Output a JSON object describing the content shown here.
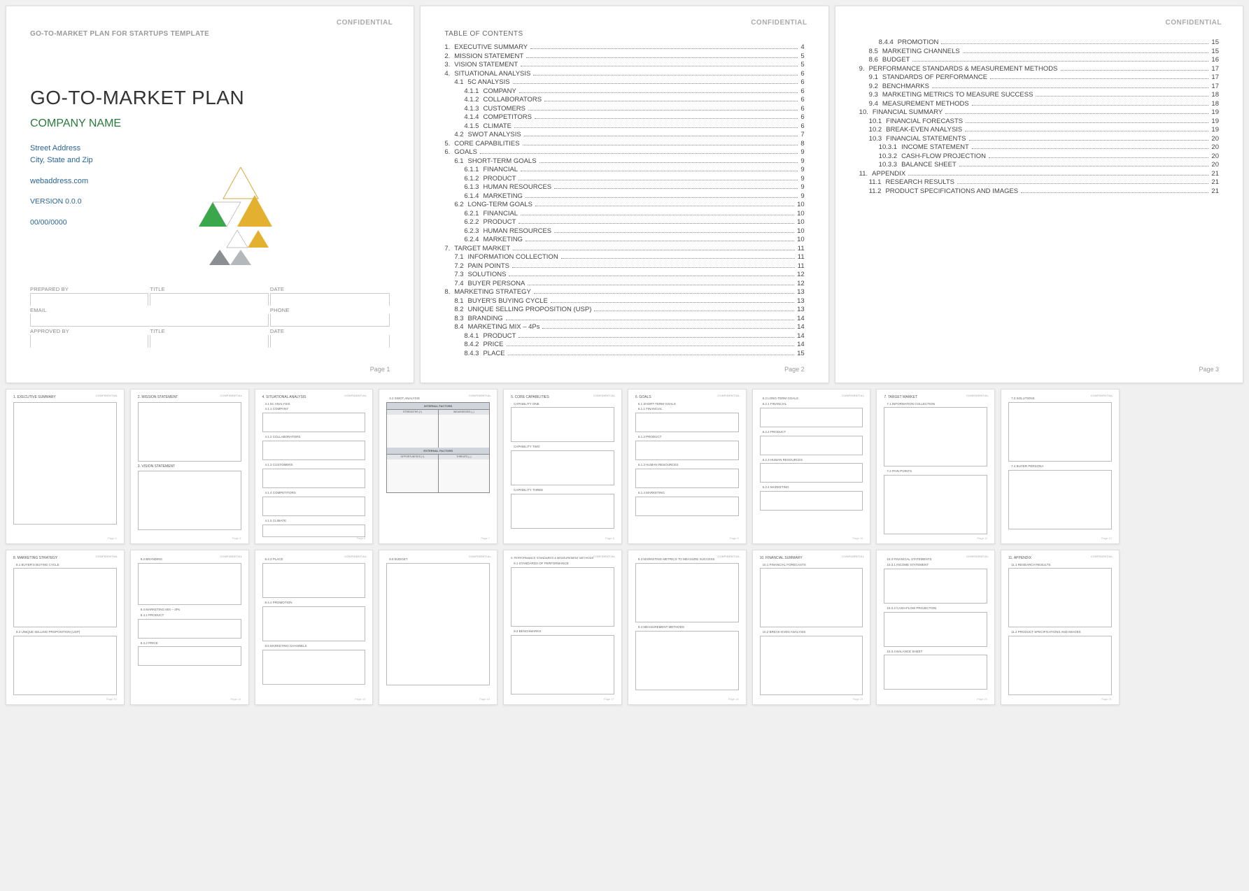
{
  "confidential": "CONFIDENTIAL",
  "template_header": "GO-TO-MARKET PLAN FOR STARTUPS TEMPLATE",
  "main_title": "GO-TO-MARKET PLAN",
  "company": "COMPANY NAME",
  "street": "Street Address",
  "city": "City, State and Zip",
  "web": "webaddress.com",
  "version": "VERSION 0.0.0",
  "date": "00/00/0000",
  "form": {
    "prepared_by": "PREPARED BY",
    "title": "TITLE",
    "date": "DATE",
    "email": "EMAIL",
    "phone": "PHONE",
    "approved_by": "APPROVED BY"
  },
  "pages": {
    "p1": "Page 1",
    "p2": "Page 2",
    "p3": "Page 3"
  },
  "toc_title": "TABLE OF CONTENTS",
  "toc_page2": [
    {
      "n": "1.",
      "t": "EXECUTIVE SUMMARY",
      "p": "4",
      "i": 0
    },
    {
      "n": "2.",
      "t": "MISSION STATEMENT",
      "p": "5",
      "i": 0
    },
    {
      "n": "3.",
      "t": "VISION STATEMENT",
      "p": "5",
      "i": 0
    },
    {
      "n": "4.",
      "t": "SITUATIONAL ANALYSIS",
      "p": "6",
      "i": 0
    },
    {
      "n": "4.1",
      "t": "5C ANALYSIS",
      "p": "6",
      "i": 1
    },
    {
      "n": "4.1.1",
      "t": "COMPANY",
      "p": "6",
      "i": 2
    },
    {
      "n": "4.1.2",
      "t": "COLLABORATORS",
      "p": "6",
      "i": 2
    },
    {
      "n": "4.1.3",
      "t": "CUSTOMERS",
      "p": "6",
      "i": 2
    },
    {
      "n": "4.1.4",
      "t": "COMPETITORS",
      "p": "6",
      "i": 2
    },
    {
      "n": "4.1.5",
      "t": "CLIMATE",
      "p": "6",
      "i": 2
    },
    {
      "n": "4.2",
      "t": "SWOT ANALYSIS",
      "p": "7",
      "i": 1
    },
    {
      "n": "5.",
      "t": "CORE CAPABILITIES",
      "p": "8",
      "i": 0
    },
    {
      "n": "6.",
      "t": "GOALS",
      "p": "9",
      "i": 0
    },
    {
      "n": "6.1",
      "t": "SHORT-TERM GOALS",
      "p": "9",
      "i": 1
    },
    {
      "n": "6.1.1",
      "t": "FINANCIAL",
      "p": "9",
      "i": 2
    },
    {
      "n": "6.1.2",
      "t": "PRODUCT",
      "p": "9",
      "i": 2
    },
    {
      "n": "6.1.3",
      "t": "HUMAN RESOURCES",
      "p": "9",
      "i": 2
    },
    {
      "n": "6.1.4",
      "t": "MARKETING",
      "p": "9",
      "i": 2
    },
    {
      "n": "6.2",
      "t": "LONG-TERM GOALS",
      "p": "10",
      "i": 1
    },
    {
      "n": "6.2.1",
      "t": "FINANCIAL",
      "p": "10",
      "i": 2
    },
    {
      "n": "6.2.2",
      "t": "PRODUCT",
      "p": "10",
      "i": 2
    },
    {
      "n": "6.2.3",
      "t": "HUMAN RESOURCES",
      "p": "10",
      "i": 2
    },
    {
      "n": "6.2.4",
      "t": "MARKETING",
      "p": "10",
      "i": 2
    },
    {
      "n": "7.",
      "t": "TARGET MARKET",
      "p": "11",
      "i": 0
    },
    {
      "n": "7.1",
      "t": "INFORMATION COLLECTION",
      "p": "11",
      "i": 1
    },
    {
      "n": "7.2",
      "t": "PAIN POINTS",
      "p": "11",
      "i": 1
    },
    {
      "n": "7.3",
      "t": "SOLUTIONS",
      "p": "12",
      "i": 1
    },
    {
      "n": "7.4",
      "t": "BUYER PERSONA",
      "p": "12",
      "i": 1
    },
    {
      "n": "8.",
      "t": "MARKETING STRATEGY",
      "p": "13",
      "i": 0
    },
    {
      "n": "8.1",
      "t": "BUYER'S BUYING CYCLE",
      "p": "13",
      "i": 1
    },
    {
      "n": "8.2",
      "t": "UNIQUE SELLING PROPOSITION (USP)",
      "p": "13",
      "i": 1
    },
    {
      "n": "8.3",
      "t": "BRANDING",
      "p": "14",
      "i": 1
    },
    {
      "n": "8.4",
      "t": "MARKETING MIX – 4Ps",
      "p": "14",
      "i": 1
    },
    {
      "n": "8.4.1",
      "t": "PRODUCT",
      "p": "14",
      "i": 2
    },
    {
      "n": "8.4.2",
      "t": "PRICE",
      "p": "14",
      "i": 2
    },
    {
      "n": "8.4.3",
      "t": "PLACE",
      "p": "15",
      "i": 2
    }
  ],
  "toc_page3": [
    {
      "n": "8.4.4",
      "t": "PROMOTION",
      "p": "15",
      "i": 2
    },
    {
      "n": "8.5",
      "t": "MARKETING CHANNELS",
      "p": "15",
      "i": 1
    },
    {
      "n": "8.6",
      "t": "BUDGET",
      "p": "16",
      "i": 1
    },
    {
      "n": "9.",
      "t": "PERFORMANCE STANDARDS & MEASUREMENT METHODS",
      "p": "17",
      "i": 0
    },
    {
      "n": "9.1",
      "t": "STANDARDS OF PERFORMANCE",
      "p": "17",
      "i": 1
    },
    {
      "n": "9.2",
      "t": "BENCHMARKS",
      "p": "17",
      "i": 1
    },
    {
      "n": "9.3",
      "t": "MARKETING METRICS TO MEASURE SUCCESS",
      "p": "18",
      "i": 1
    },
    {
      "n": "9.4",
      "t": "MEASUREMENT METHODS",
      "p": "18",
      "i": 1
    },
    {
      "n": "10.",
      "t": "FINANCIAL SUMMARY",
      "p": "19",
      "i": 0
    },
    {
      "n": "10.1",
      "t": "FINANCIAL FORECASTS",
      "p": "19",
      "i": 1
    },
    {
      "n": "10.2",
      "t": "BREAK-EVEN ANALYSIS",
      "p": "19",
      "i": 1
    },
    {
      "n": "10.3",
      "t": "FINANCIAL STATEMENTS",
      "p": "20",
      "i": 1
    },
    {
      "n": "10.3.1",
      "t": "INCOME STATEMENT",
      "p": "20",
      "i": 2
    },
    {
      "n": "10.3.2",
      "t": "CASH-FLOW PROJECTION",
      "p": "20",
      "i": 2
    },
    {
      "n": "10.3.3",
      "t": "BALANCE SHEET",
      "p": "20",
      "i": 2
    },
    {
      "n": "11.",
      "t": "APPENDIX",
      "p": "21",
      "i": 0
    },
    {
      "n": "11.1",
      "t": "RESEARCH RESULTS",
      "p": "21",
      "i": 1
    },
    {
      "n": "11.2",
      "t": "PRODUCT SPECIFICATIONS AND IMAGES",
      "p": "21",
      "i": 1
    }
  ],
  "thumb_pages": {
    "p4": "Page 4",
    "p5": "Page 5",
    "p6": "Page 6",
    "p7": "Page 7",
    "p8": "Page 8",
    "p9": "Page 9",
    "p10": "Page 10",
    "p11": "Page 11",
    "p12": "Page 12",
    "p13": "Page 13",
    "p14": "Page 14",
    "p15": "Page 15",
    "p16": "Page 16",
    "p17": "Page 17",
    "p18": "Page 18",
    "p19": "Page 19",
    "p20": "Page 20",
    "p21": "Page 21"
  },
  "thumbs": {
    "p4_h": "1. EXECUTIVE SUMMARY",
    "p5_h1": "2. MISSION STATEMENT",
    "p5_h2": "3. VISION STATEMENT",
    "p6_h": "4. SITUATIONAL ANALYSIS",
    "p6_s1": "4.1  5C ANALYSIS",
    "p6_s2": "4.1.1  COMPANY",
    "p6_s3": "4.1.2  COLLABORATORS",
    "p6_s4": "4.1.3  CUSTOMERS",
    "p6_s5": "4.1.4  COMPETITORS",
    "p6_s6": "4.1.5  CLIMATE",
    "p7_s1": "4.2  SWOT ANALYSIS",
    "p7_int": "INTERNAL FACTORS",
    "p7_ext": "EXTERNAL FACTORS",
    "p7_str": "STRENGTHS (+)",
    "p7_wea": "WEAKNESSES (–)",
    "p7_opp": "OPPORTUNITIES (+)",
    "p7_thr": "THREATS (–)",
    "p8_h": "5. CORE CAPABILITIES",
    "p8_s1": "CAPABILITY ONE",
    "p8_s2": "CAPABILITY TWO",
    "p8_s3": "CAPABILITY THREE",
    "p9_h": "6. GOALS",
    "p9_s1": "6.1  SHORT-TERM GOALS",
    "p9_s2": "6.1.1  FINANCIAL",
    "p9_s3": "6.1.2  PRODUCT",
    "p9_s4": "6.1.3  HUMAN RESOURCES",
    "p9_s5": "6.1.4  MARKETING",
    "p10_s1": "6.2  LONG-TERM GOALS",
    "p10_s2": "6.2.1  FINANCIAL",
    "p10_s3": "6.2.2  PRODUCT",
    "p10_s4": "6.2.3  HUMAN RESOURCES",
    "p10_s5": "6.2.4  MARKETING",
    "p11_h": "7. TARGET MARKET",
    "p11_s1": "7.1  INFORMATION COLLECTION",
    "p11_s2": "7.2  PAIN POINTS",
    "p12_s1": "7.3  SOLUTIONS",
    "p12_s2": "7.4  BUYER PERSONA",
    "p13_h": "8. MARKETING STRATEGY",
    "p13_s1": "8.1  BUYER'S BUYING CYCLE",
    "p13_s2": "8.2  UNIQUE SELLING PROPOSITION (USP)",
    "p14_s1": "8.3  BRANDING",
    "p14_s2": "8.4  MARKETING MIX – 4Ps",
    "p14_s3": "8.4.1  PRODUCT",
    "p14_s4": "8.4.2  PRICE",
    "p15_s1": "8.4.3  PLACE",
    "p15_s2": "8.4.4  PROMOTION",
    "p15_s3": "8.5  MARKETING CHANNELS",
    "p16_s1": "8.6  BUDGET",
    "p17_h": "9. PERFORMANCE STANDARDS & MEASUREMENT METHODS",
    "p17_s1": "9.1  STANDARDS OF PERFORMANCE",
    "p17_s2": "9.2  BENCHMARKS",
    "p18_s1": "9.3  MARKETING METRICS TO MEASURE SUCCESS",
    "p18_s2": "9.4  MEASUREMENT METHODS",
    "p19_h": "10. FINANCIAL SUMMARY",
    "p19_s1": "10.1  FINANCIAL FORECASTS",
    "p19_s2": "10.2  BREAK-EVEN ANALYSIS",
    "p20_s1": "10.3  FINANCIAL STATEMENTS",
    "p20_s2": "10.3.1  INCOME STATEMENT",
    "p20_s3": "10.3.2  CASH-FLOW PROJECTION",
    "p20_s4": "10.3.3  BALANCE SHEET",
    "p21_h": "11. APPENDIX",
    "p21_s1": "11.1  RESEARCH RESULTS",
    "p21_s2": "11.2  PRODUCT SPECIFICATIONS AND IMAGES"
  }
}
